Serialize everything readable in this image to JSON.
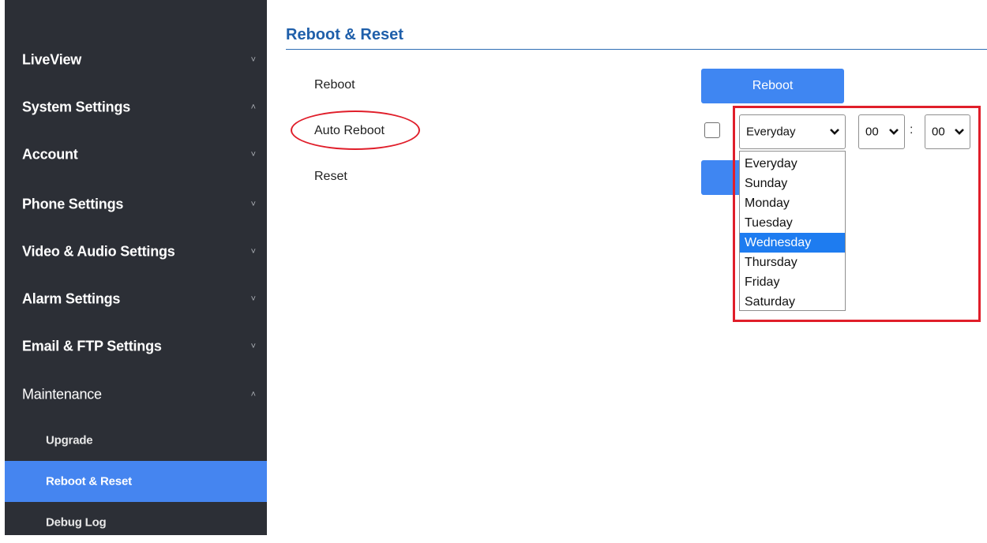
{
  "sidebar": {
    "items": [
      {
        "label": "LiveView",
        "chevron": "˅"
      },
      {
        "label": "System Settings",
        "chevron": "˄"
      },
      {
        "label": "Account",
        "chevron": "˅"
      },
      {
        "label": "Phone Settings",
        "chevron": "˅"
      },
      {
        "label": "Video & Audio Settings",
        "chevron": "˅"
      },
      {
        "label": "Alarm Settings",
        "chevron": "˅"
      },
      {
        "label": "Email & FTP Settings",
        "chevron": "˅"
      },
      {
        "label": "Maintenance",
        "chevron": "˄"
      }
    ],
    "sub_items": [
      {
        "label": "Upgrade"
      },
      {
        "label": "Reboot & Reset",
        "active": true
      },
      {
        "label": "Debug Log"
      }
    ]
  },
  "main": {
    "title": "Reboot & Reset",
    "rows": {
      "reboot_label": "Reboot",
      "auto_reboot_label": "Auto Reboot",
      "reset_label": "Reset"
    },
    "reboot_button": "Reboot",
    "auto_reboot": {
      "checked": false,
      "day_value": "Everyday",
      "hour_value": "00",
      "minute_value": "00",
      "separator": ":",
      "day_options": [
        "Everyday",
        "Sunday",
        "Monday",
        "Tuesday",
        "Wednesday",
        "Thursday",
        "Friday",
        "Saturday"
      ],
      "highlighted_option": "Wednesday"
    }
  },
  "colors": {
    "sidebar_bg": "#2c2f36",
    "active_item": "#4585f0",
    "button": "#3f86f2",
    "title": "#1f5faa",
    "annotation": "#e01e2a",
    "highlight": "#1e7cf0"
  }
}
